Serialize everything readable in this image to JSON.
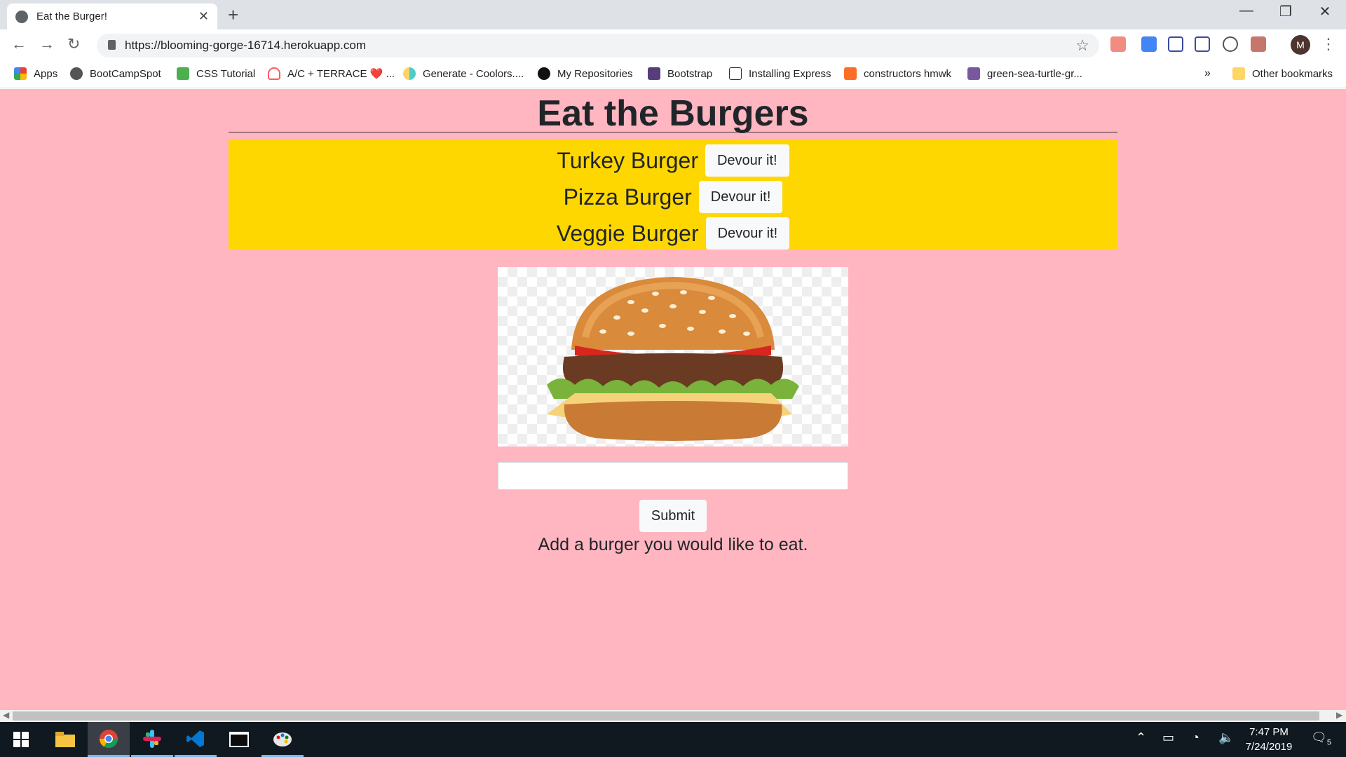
{
  "browser": {
    "tab_title": "Eat the Burger!",
    "new_tab": "+",
    "url": "https://blooming-gorge-16714.herokuapp.com",
    "profile_initial": "M",
    "window_controls": {
      "minimize": "—",
      "restore": "❐",
      "close": "✕"
    }
  },
  "bookmarks": [
    {
      "label": "Apps",
      "icon": "apps-grid-icon"
    },
    {
      "label": "BootCampSpot",
      "icon": "globe-icon"
    },
    {
      "label": "CSS Tutorial",
      "icon": "w3-icon"
    },
    {
      "label": "A/C + TERRACE ❤️ ...",
      "icon": "airbnb-icon"
    },
    {
      "label": "Generate - Coolors....",
      "icon": "coolors-icon"
    },
    {
      "label": "My Repositories",
      "icon": "github-icon"
    },
    {
      "label": "Bootstrap",
      "icon": "bootstrap-icon"
    },
    {
      "label": "Installing Express",
      "icon": "express-icon"
    },
    {
      "label": "constructors hmwk",
      "icon": "gitlab-icon"
    },
    {
      "label": "green-sea-turtle-gr...",
      "icon": "heroku-icon"
    }
  ],
  "bookmarks_overflow": "»",
  "other_bookmarks": "Other bookmarks",
  "page": {
    "title": "Eat the Burgers",
    "burgers": [
      {
        "name": "Turkey Burger",
        "button": "Devour it!"
      },
      {
        "name": "Pizza Burger",
        "button": "Devour it!"
      },
      {
        "name": "Veggie Burger",
        "button": "Devour it!"
      }
    ],
    "input_value": "",
    "submit_label": "Submit",
    "hint": "Add a burger you would like to eat."
  },
  "taskbar": {
    "time": "7:47 PM",
    "date": "7/24/2019",
    "notifications": "5"
  },
  "colors": {
    "page_bg": "#ffb6c1",
    "list_bg": "#ffd700",
    "taskbar_bg": "#101820"
  }
}
